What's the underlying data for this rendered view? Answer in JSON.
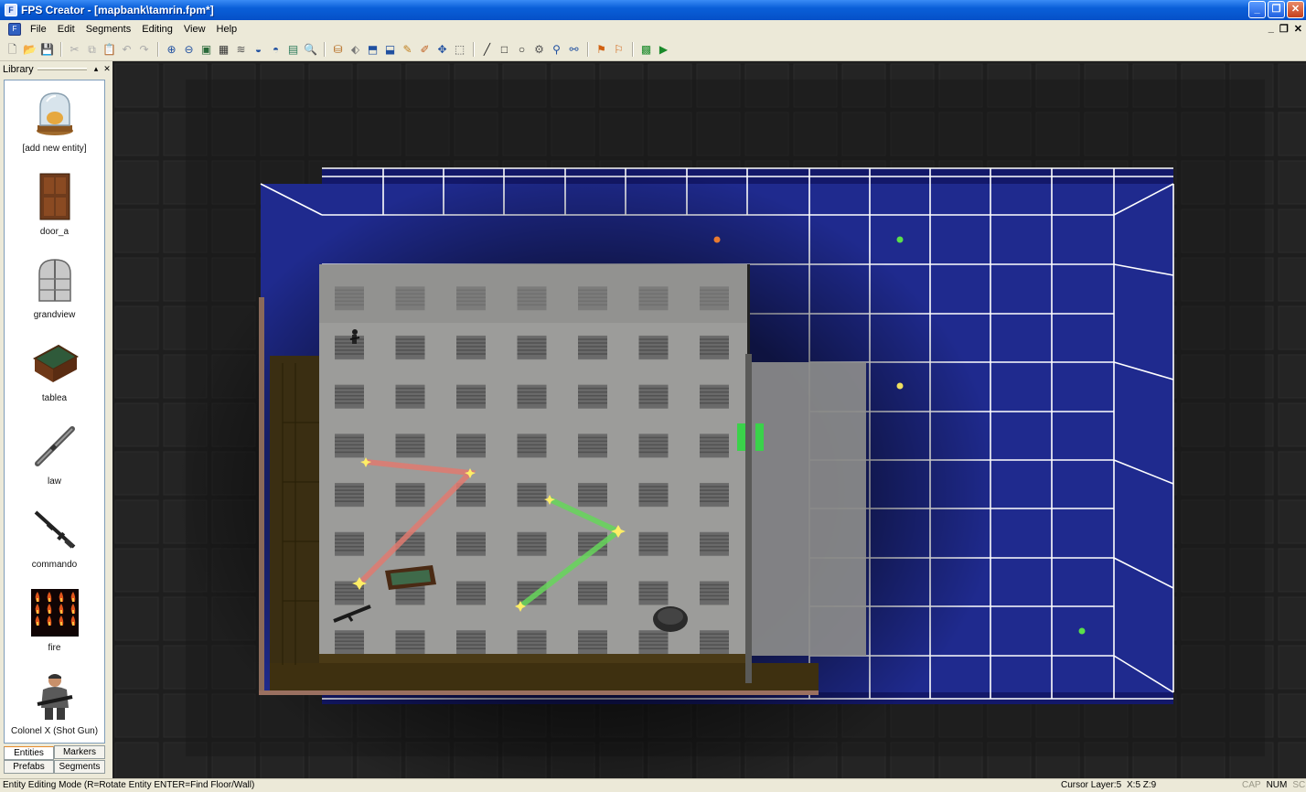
{
  "window": {
    "title": "FPS Creator - [mapbank\\tamrin.fpm*]"
  },
  "menu": [
    "File",
    "Edit",
    "Segments",
    "Editing",
    "View",
    "Help"
  ],
  "library": {
    "title": "Library",
    "items": [
      {
        "label": "[add new entity]",
        "icon": "glass-dome-icon"
      },
      {
        "label": "door_a",
        "icon": "door-icon"
      },
      {
        "label": "grandview",
        "icon": "window-icon"
      },
      {
        "label": "tablea",
        "icon": "table-icon"
      },
      {
        "label": "law",
        "icon": "rocket-launcher-icon"
      },
      {
        "label": "commando",
        "icon": "rifle-icon"
      },
      {
        "label": "fire",
        "icon": "fire-icon"
      },
      {
        "label": "Colonel X (Shot Gun)",
        "icon": "soldier-icon"
      }
    ],
    "tabs": [
      "Entities",
      "Markers",
      "Prefabs",
      "Segments"
    ]
  },
  "status": {
    "mode": "Entity Editing Mode (R=Rotate Entity  ENTER=Find Floor/Wall)",
    "layer": "Cursor Layer:5",
    "coords": "X:5  Z:9",
    "caps": "CAP",
    "num": "NUM",
    "scrl": "SCRL"
  },
  "colors": {
    "titlebar": "#0a5fd8",
    "grid_blue": "#1e2a8c",
    "floor": "#9a9a98",
    "waypoint_red": "#e07a70",
    "waypoint_green": "#66d65a"
  }
}
